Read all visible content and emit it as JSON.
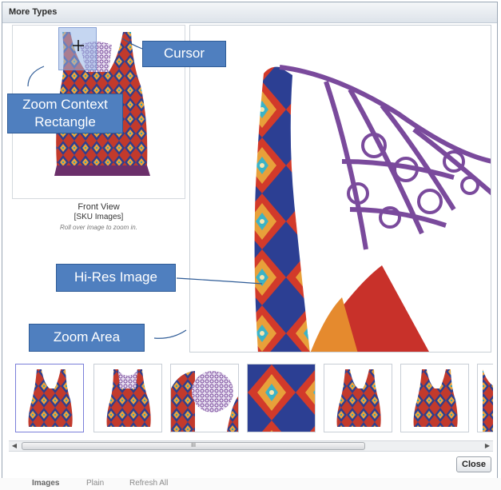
{
  "dialog": {
    "title": "More Types"
  },
  "preview": {
    "view_name": "Front View",
    "source": "[SKU Images]",
    "hint": "Roll over image to zoom in."
  },
  "annotations": {
    "cursor": "Cursor",
    "zoom_context": "Zoom Context Rectangle",
    "hires": "Hi-Res Image",
    "zoom_area": "Zoom Area"
  },
  "thumbnails": [
    {
      "alt": "tank-front",
      "selected": true
    },
    {
      "alt": "tank-back",
      "selected": false
    },
    {
      "alt": "crochet-detail",
      "selected": false
    },
    {
      "alt": "fabric-pattern",
      "selected": false
    },
    {
      "alt": "tank-front-2",
      "selected": false
    },
    {
      "alt": "tank-front-3",
      "selected": false
    },
    {
      "alt": "tank-back-partial",
      "selected": false
    }
  ],
  "scrollbar": {
    "grip": "III"
  },
  "buttons": {
    "close": "Close"
  },
  "background_tabs": [
    "Images",
    "Plain",
    "Refresh All"
  ],
  "colors": {
    "callout": "#4f7fbf",
    "titlebar": "#dde3ea",
    "crochet": "#7a4a9c"
  }
}
